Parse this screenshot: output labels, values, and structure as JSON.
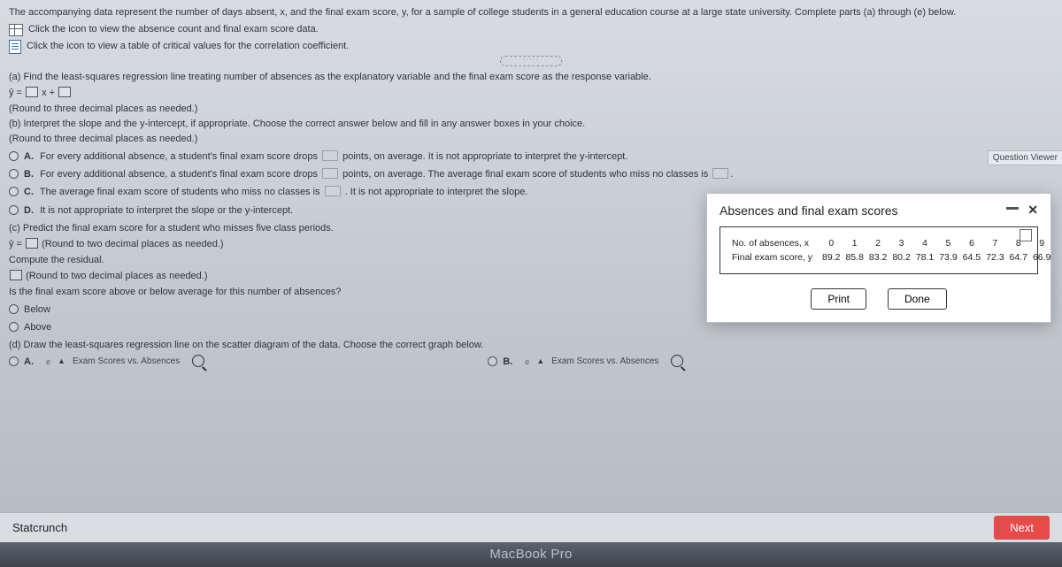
{
  "intro": {
    "main": "The accompanying data represent the number of days absent, x, and the final exam score, y, for a sample of college students in a general education course at a large state university. Complete parts (a) through (e) below.",
    "link1": "Click the icon to view the absence count and final exam score data.",
    "link2": "Click the icon to view a table of critical values for the correlation coefficient."
  },
  "parts": {
    "a": {
      "prompt": "(a) Find the least-squares regression line treating number of absences as the explanatory variable and the final exam score as the response variable.",
      "eq_left": "ŷ =",
      "eq_mid": "x +",
      "hint": "(Round to three decimal places as needed.)"
    },
    "b": {
      "prompt": "(b) Interpret the slope and the y-intercept, if appropriate. Choose the correct answer below and fill in any answer boxes in your choice.",
      "hint": "(Round to three decimal places as needed.)",
      "A1": "For every additional absence, a student's final exam score drops",
      "A2": "points, on average. It is not appropriate to interpret the y-intercept.",
      "B1": "For every additional absence, a student's final exam score drops",
      "B2": "points, on average. The average final exam score of students who miss no classes is",
      "C1": "The average final exam score of students who miss no classes is",
      "C2": ". It is not appropriate to interpret the slope.",
      "D": "It is not appropriate to interpret the slope or the y-intercept."
    },
    "c": {
      "prompt": "(c) Predict the final exam score for a student who misses five class periods.",
      "eq_left": "ŷ =",
      "hint1": "(Round to two decimal places as needed.)",
      "compute": "Compute the residual.",
      "hint2": "(Round to two decimal places as needed.)",
      "q": "Is the final exam score above or below average for this number of absences?",
      "below": "Below",
      "above": "Above"
    },
    "d": {
      "prompt": "(d) Draw the least-squares regression line on the scatter diagram of the data. Choose the correct graph below.",
      "title": "Exam Scores vs. Absences"
    }
  },
  "popup": {
    "title": "Absences and final exam scores",
    "row1_label": "No. of absences, x",
    "row2_label": "Final exam score, y",
    "x": [
      "0",
      "1",
      "2",
      "3",
      "4",
      "5",
      "6",
      "7",
      "8",
      "9"
    ],
    "y": [
      "89.2",
      "85.8",
      "83.2",
      "80.2",
      "78.1",
      "73.9",
      "64.5",
      "72.3",
      "64.7",
      "66.9"
    ],
    "print": "Print",
    "done": "Done"
  },
  "chart_data": {
    "type": "table",
    "title": "Absences and final exam scores",
    "columns": [
      "No. of absences, x",
      "Final exam score, y"
    ],
    "x": [
      0,
      1,
      2,
      3,
      4,
      5,
      6,
      7,
      8,
      9
    ],
    "y": [
      89.2,
      85.8,
      83.2,
      80.2,
      78.1,
      73.9,
      64.5,
      72.3,
      64.7,
      66.9
    ]
  },
  "sidebar": {
    "qv": "Question Viewer"
  },
  "footer": {
    "statcrunch": "Statcrunch",
    "next": "Next"
  },
  "device": "MacBook Pro",
  "labels": {
    "A": "A.",
    "B": "B.",
    "C": "C.",
    "D": "D."
  }
}
